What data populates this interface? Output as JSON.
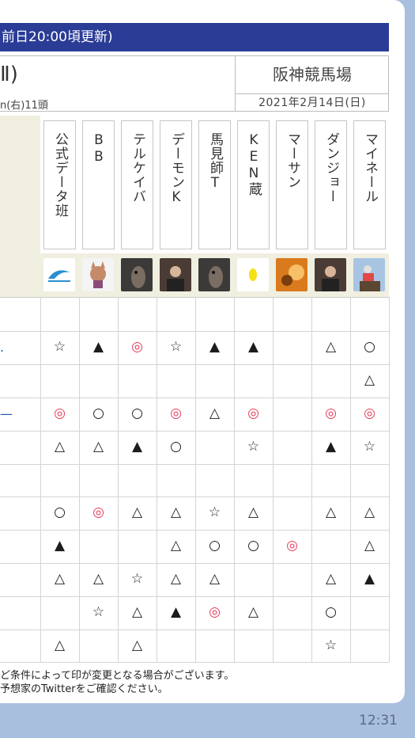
{
  "banner": "前日20:00頃更新)",
  "race": {
    "title": "Ⅱ)",
    "sub": "n(右)11頭",
    "venue": "阪神競馬場",
    "date": "2021年2月14日(日)"
  },
  "predictors": [
    {
      "name": "公式データ班",
      "avatar": "logo-icon"
    },
    {
      "name": "BB",
      "avatar": "cat-avatar"
    },
    {
      "name": "テルケイバ",
      "avatar": "horse-avatar"
    },
    {
      "name": "デーモンK",
      "avatar": "man-avatar"
    },
    {
      "name": "馬見師T",
      "avatar": "horse-avatar"
    },
    {
      "name": "KEN蔵",
      "avatar": "yellow-avatar"
    },
    {
      "name": "マーサン",
      "avatar": "orange-avatar"
    },
    {
      "name": "ダンジョー",
      "avatar": "man-avatar"
    },
    {
      "name": "マイネール",
      "avatar": "jockey-avatar"
    }
  ],
  "rows": [
    [
      "",
      "",
      "",
      "",
      "",
      "",
      "",
      "",
      ""
    ],
    [
      "☆",
      "▲",
      "◎",
      "☆",
      "▲",
      "▲",
      "",
      "△",
      "○"
    ],
    [
      "",
      "",
      "",
      "",
      "",
      "",
      "",
      "",
      "△"
    ],
    [
      "◎",
      "○",
      "○",
      "◎",
      "△",
      "◎",
      "",
      "◎",
      "◎"
    ],
    [
      "△",
      "△",
      "▲",
      "○",
      "",
      "☆",
      "",
      "▲",
      "☆"
    ],
    [
      "",
      "",
      "",
      "",
      "",
      "",
      "",
      "",
      ""
    ],
    [
      "○",
      "◎",
      "△",
      "△",
      "☆",
      "△",
      "",
      "△",
      "△"
    ],
    [
      "▲",
      "",
      "",
      "△",
      "○",
      "○",
      "◎",
      "",
      "△"
    ],
    [
      "△",
      "△",
      "☆",
      "△",
      "△",
      "",
      "",
      "△",
      "▲"
    ],
    [
      "",
      "☆",
      "△",
      "▲",
      "◎",
      "△",
      "",
      "○",
      ""
    ],
    [
      "△",
      "",
      "△",
      "",
      "",
      "",
      "",
      "☆",
      ""
    ]
  ],
  "row_edge_marks": [
    "",
    ".",
    "",
    "—",
    "",
    "",
    "",
    "",
    "",
    "",
    ""
  ],
  "notes": [
    "ど条件によって印が変更となる場合がございます。",
    "予想家のTwitterをご確認ください。"
  ],
  "status_time": "12:31",
  "colors": {
    "banner": "#2a3c96",
    "red_mark": "#e43d5a",
    "beige": "#f0efe0",
    "background": "#a9bfde"
  }
}
